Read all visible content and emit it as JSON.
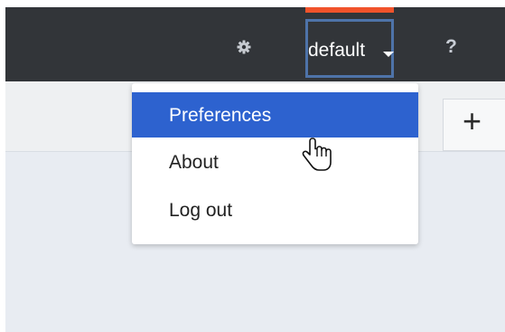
{
  "header": {
    "settings_icon": "gear-icon",
    "user_menu_label": "default",
    "help_label": "?"
  },
  "toolbar": {
    "add_label": "+"
  },
  "user_dropdown": {
    "items": [
      {
        "label": "Preferences",
        "state": "hovered"
      },
      {
        "label": "About"
      },
      {
        "label": "Log out"
      }
    ]
  },
  "colors": {
    "topbar": "#323539",
    "accent": "#f1532b",
    "highlight": "#2d62cf",
    "focus_border": "#4e73a9"
  }
}
